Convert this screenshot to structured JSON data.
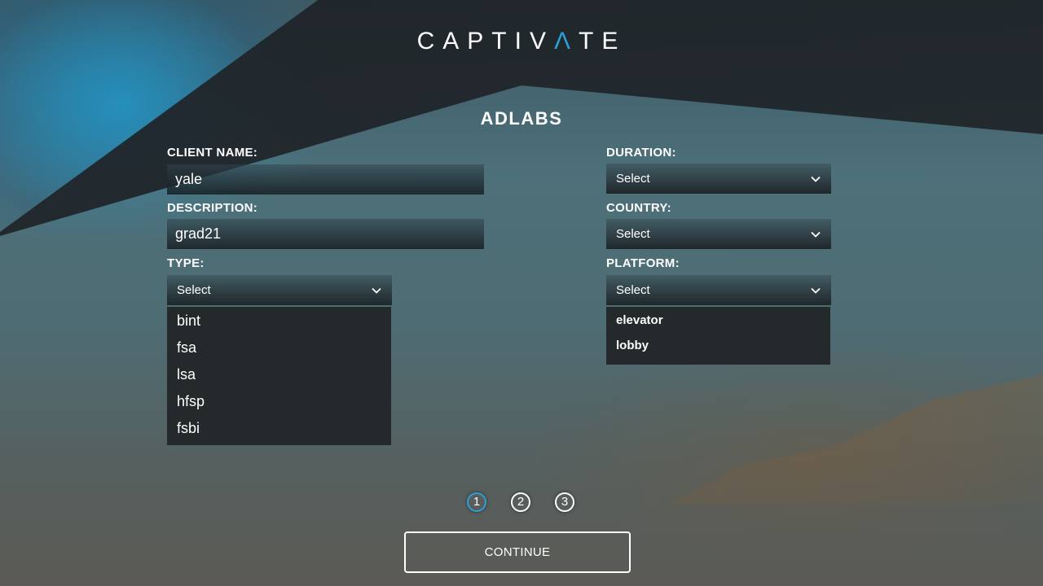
{
  "brand": {
    "logo_prefix": "CAPTIV",
    "logo_accent": "Λ",
    "logo_suffix": "TE",
    "accent_color": "#2a9fd8"
  },
  "page": {
    "title": "ADLABS"
  },
  "form": {
    "client_name": {
      "label": "CLIENT NAME:",
      "value": "yale"
    },
    "description": {
      "label": "DESCRIPTION:",
      "value": "grad21"
    },
    "type": {
      "label": "TYPE:",
      "selected": "Select",
      "options": [
        "bint",
        "fsa",
        "lsa",
        "hfsp",
        "fsbi"
      ]
    },
    "duration": {
      "label": "DURATION:",
      "selected": "Select"
    },
    "country": {
      "label": "COUNTRY:",
      "selected": "Select"
    },
    "platform": {
      "label": "PLATFORM:",
      "selected": "Select",
      "options": [
        "elevator",
        "lobby"
      ]
    }
  },
  "steps": [
    "1",
    "2",
    "3"
  ],
  "continue_label": "CONTINUE"
}
